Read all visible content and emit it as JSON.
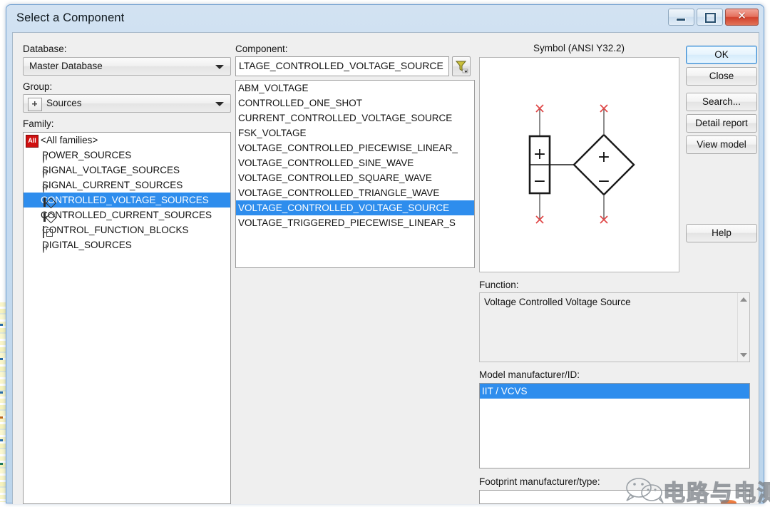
{
  "window": {
    "title": "Select a Component",
    "buttons": {
      "minimize": "minimize",
      "maximize": "maximize",
      "close": "close",
      "close_glyph": "✕"
    }
  },
  "left_panel": {
    "database_label": "Database:",
    "database_value": "Master Database",
    "group_label": "Group:",
    "group_value": "Sources",
    "family_label": "Family:",
    "families": [
      {
        "label": "<All families>",
        "icon": "all-families-icon",
        "selected": false
      },
      {
        "label": "POWER_SOURCES",
        "icon": "power-source-icon",
        "selected": false
      },
      {
        "label": "SIGNAL_VOLTAGE_SOURCES",
        "icon": "signal-voltage-source-icon",
        "selected": false
      },
      {
        "label": "SIGNAL_CURRENT_SOURCES",
        "icon": "signal-current-source-icon",
        "selected": false
      },
      {
        "label": "CONTROLLED_VOLTAGE_SOURCES",
        "icon": "controlled-voltage-source-icon",
        "selected": true
      },
      {
        "label": "CONTROLLED_CURRENT_SOURCES",
        "icon": "controlled-current-source-icon",
        "selected": false
      },
      {
        "label": "CONTROL_FUNCTION_BLOCKS",
        "icon": "control-function-block-icon",
        "selected": false
      },
      {
        "label": "DIGITAL_SOURCES",
        "icon": "digital-source-icon",
        "selected": false
      }
    ],
    "all_badge_text": "All"
  },
  "component_panel": {
    "label": "Component:",
    "field_value": "LTAGE_CONTROLLED_VOLTAGE_SOURCE",
    "filter_button": "filter-icon",
    "items": [
      {
        "label": "ABM_VOLTAGE",
        "selected": false
      },
      {
        "label": "CONTROLLED_ONE_SHOT",
        "selected": false
      },
      {
        "label": "CURRENT_CONTROLLED_VOLTAGE_SOURCE",
        "selected": false
      },
      {
        "label": "FSK_VOLTAGE",
        "selected": false
      },
      {
        "label": "VOLTAGE_CONTROLLED_PIECEWISE_LINEAR_",
        "selected": false
      },
      {
        "label": "VOLTAGE_CONTROLLED_SINE_WAVE",
        "selected": false
      },
      {
        "label": "VOLTAGE_CONTROLLED_SQUARE_WAVE",
        "selected": false
      },
      {
        "label": "VOLTAGE_CONTROLLED_TRIANGLE_WAVE",
        "selected": false
      },
      {
        "label": "VOLTAGE_CONTROLLED_VOLTAGE_SOURCE",
        "selected": true
      },
      {
        "label": "VOLTAGE_TRIGGERED_PIECEWISE_LINEAR_S",
        "selected": false
      }
    ]
  },
  "symbol_panel": {
    "title": "Symbol (ANSI Y32.2)",
    "symbol_name": "voltage-controlled-voltage-source-symbol",
    "plus_sign": "+",
    "minus_sign": "−"
  },
  "function_panel": {
    "label": "Function:",
    "text": "Voltage Controlled Voltage Source"
  },
  "model_panel": {
    "label": "Model manufacturer/ID:",
    "items": [
      {
        "label": "IIT / VCVS",
        "selected": true
      }
    ]
  },
  "footprint_panel": {
    "label": "Footprint manufacturer/type:",
    "items": []
  },
  "action_buttons": [
    {
      "label": "OK",
      "name": "ok-button",
      "default": true
    },
    {
      "label": "Close",
      "name": "close-button",
      "default": false
    },
    {
      "label": "Search...",
      "name": "search-button",
      "default": false
    },
    {
      "label": "Detail report",
      "name": "detail-report-button",
      "default": false
    },
    {
      "label": "View model",
      "name": "view-model-button",
      "default": false
    },
    {
      "label": "Help",
      "name": "help-button",
      "default": false
    }
  ],
  "watermark": {
    "text": "电路与电测",
    "logo": "wechat-logo"
  },
  "colors": {
    "selection_blue": "#2e8ded",
    "title_glass": "#c5dbf0",
    "close_red": "#d2412c",
    "terminal_red": "#e04848"
  }
}
